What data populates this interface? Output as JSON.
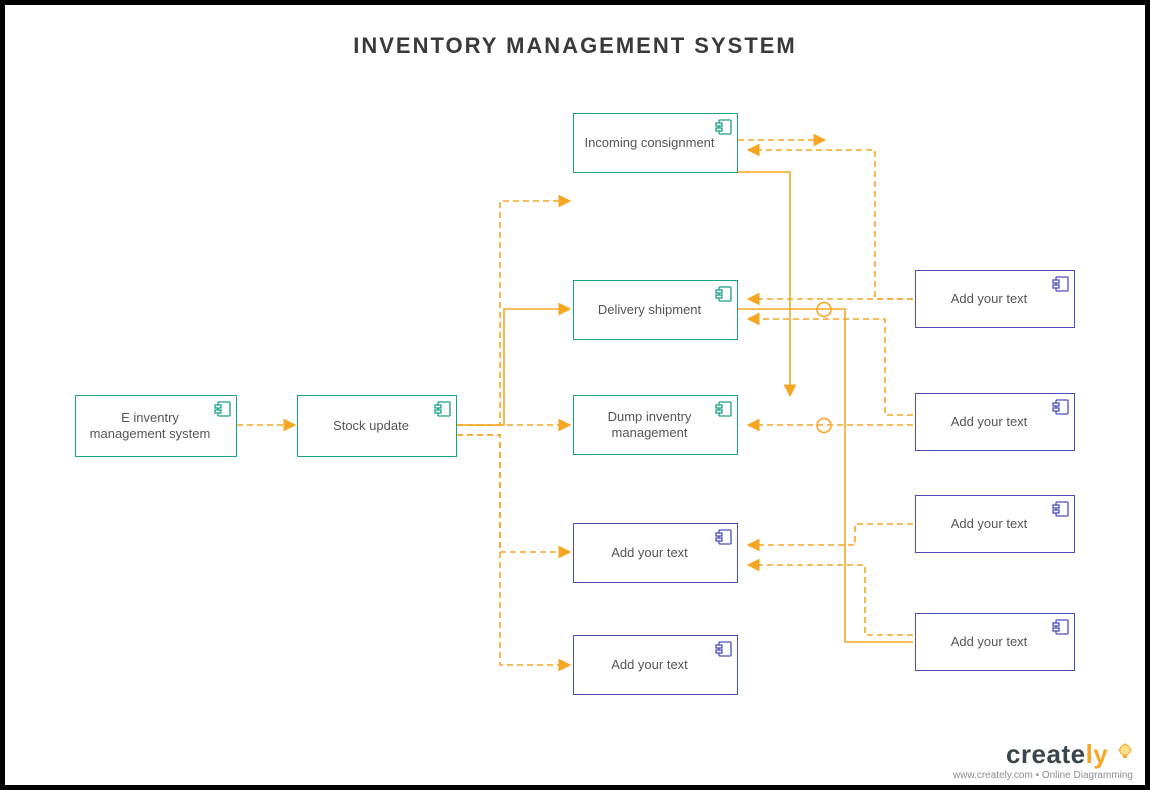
{
  "title": "INVENTORY MANAGEMENT SYSTEM",
  "colors": {
    "teal": "#1aa18a",
    "purple": "#4a4fbf",
    "connector": "#f6a623"
  },
  "nodes": {
    "n1": "E inventry management system",
    "n2": "Stock update",
    "n3": "Incoming consignment",
    "n4": "Delivery shipment",
    "n5": "Dump inventry management",
    "n6": "Add your text",
    "n7": "Add your text",
    "r1": "Add your text",
    "r2": "Add your text",
    "r3": "Add your text",
    "r4": "Add your text"
  },
  "brand": {
    "name_a": "create",
    "name_b": "ly",
    "tagline": "www.creately.com • Online Diagramming"
  }
}
